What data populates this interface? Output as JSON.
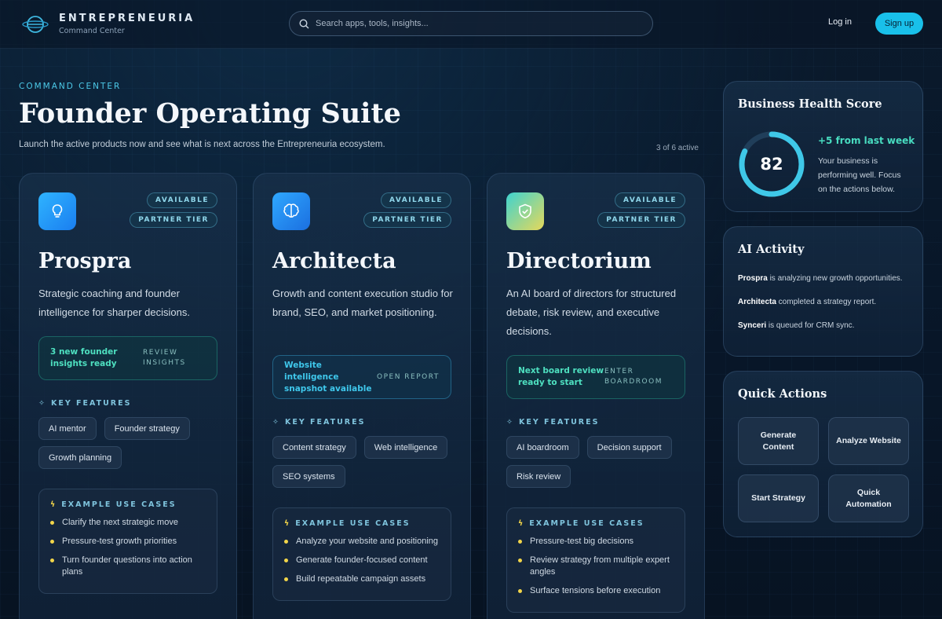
{
  "header": {
    "brand_name": "ENTREPRENEURIA",
    "brand_sub": "Command Center",
    "search_placeholder": "Search apps, tools, insights...",
    "login": "Log in",
    "signup": "Sign up"
  },
  "hero": {
    "eyebrow": "COMMAND CENTER",
    "title": "Founder Operating Suite",
    "subtitle": "Launch the active products now and see what is next across the Entrepreneuria ecosystem.",
    "active_count": "3 of 6 active"
  },
  "cards": [
    {
      "icon": "lightbulb-icon",
      "badge1": "AVAILABLE",
      "badge2": "PARTNER TIER",
      "title": "Prospra",
      "desc": "Strategic coaching and founder intelligence for sharper decisions.",
      "callout_text": "3 new founder insights ready",
      "callout_action": "REVIEW INSIGHTS",
      "callout_color": "#4ee0c0",
      "features_head": "KEY FEATURES",
      "features": [
        "AI mentor",
        "Founder strategy",
        "Growth planning"
      ],
      "usecases_head": "EXAMPLE USE CASES",
      "usecases": [
        "Clarify the next strategic move",
        "Pressure-test growth priorities",
        "Turn founder questions into action plans"
      ]
    },
    {
      "icon": "brain-icon",
      "badge1": "AVAILABLE",
      "badge2": "PARTNER TIER",
      "title": "Architecta",
      "desc": "Growth and content execution studio for brand, SEO, and market positioning.",
      "callout_text": "Website intelligence snapshot available",
      "callout_action": "OPEN REPORT",
      "callout_color": "#3fc8ec",
      "features_head": "KEY FEATURES",
      "features": [
        "Content strategy",
        "Web intelligence",
        "SEO systems"
      ],
      "usecases_head": "EXAMPLE USE CASES",
      "usecases": [
        "Analyze your website and positioning",
        "Generate founder-focused content",
        "Build repeatable campaign assets"
      ]
    },
    {
      "icon": "shield-check-icon",
      "badge1": "AVAILABLE",
      "badge2": "PARTNER TIER",
      "title": "Directorium",
      "desc": "An AI board of directors for structured debate, risk review, and executive decisions.",
      "callout_text": "Next board review ready to start",
      "callout_action": "ENTER BOARDROOM",
      "callout_color": "#4ee0c0",
      "features_head": "KEY FEATURES",
      "features": [
        "AI boardroom",
        "Decision support",
        "Risk review"
      ],
      "usecases_head": "EXAMPLE USE CASES",
      "usecases": [
        "Pressure-test big decisions",
        "Review strategy from multiple expert angles",
        "Surface tensions before execution"
      ]
    }
  ],
  "health": {
    "title": "Business Health Score",
    "score": 82,
    "score_fraction": 0.82,
    "delta": "+5 from last week",
    "message": "Your business is performing well. Focus on the actions below."
  },
  "activity": {
    "title": "AI Activity",
    "items": [
      {
        "name": "Prospra",
        "text": " is analyzing new growth opportunities."
      },
      {
        "name": "Architecta",
        "text": " completed a strategy report."
      },
      {
        "name": "Synceri",
        "text": " is queued for CRM sync."
      }
    ]
  },
  "quick": {
    "title": "Quick Actions",
    "actions": [
      "Generate Content",
      "Analyze Website",
      "Start Strategy",
      "Quick Automation"
    ]
  },
  "colors": {
    "accent": "#19c0ea",
    "teal": "#4ee0c0",
    "bullet": "#f2d54a"
  }
}
